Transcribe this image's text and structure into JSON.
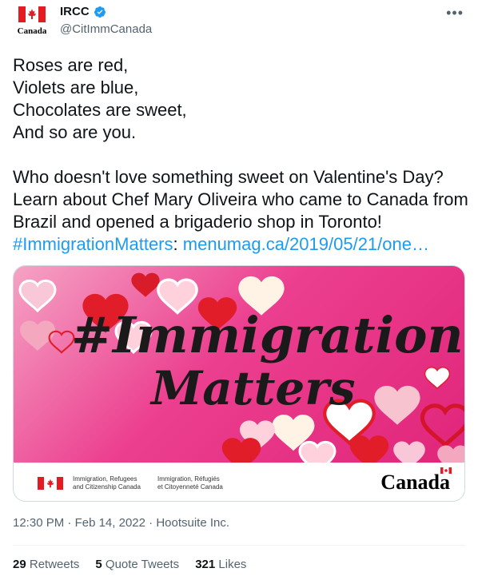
{
  "author": {
    "avatar_word": "Canada",
    "display_name": "IRCC",
    "handle": "@CitImmCanada",
    "verified": true
  },
  "tweet": {
    "text": "Roses are red,\nViolets are blue,\nChocolates are sweet,\nAnd so are you.\n\nWho doesn't love something sweet on Valentine's Day? Learn about Chef Mary Oliveira who came to Canada from Brazil and opened a brigaderio shop in Toronto!",
    "hashtag": "#ImmigrationMatters",
    "colon": ":",
    "link": "menumag.ca/2019/05/21/one…"
  },
  "media": {
    "line1": "#Immigration",
    "line2": "Matters",
    "gov_en": [
      "Immigration, Refugees",
      "and Citizenship Canada"
    ],
    "gov_fr": [
      "Immigration, Réfugiés",
      "et Citoyenneté Canada"
    ],
    "wordmark": "Canada"
  },
  "meta": {
    "time": "12:30 PM",
    "sep1": "·",
    "date": "Feb 14, 2022",
    "sep2": "·",
    "source": "Hootsuite Inc."
  },
  "stats": {
    "retweets_count": "29",
    "retweets_label": "Retweets",
    "quotes_count": "5",
    "quotes_label": "Quote Tweets",
    "likes_count": "321",
    "likes_label": "Likes"
  },
  "colors": {
    "accent": "#1d9bf0",
    "flag_red": "#e31b23",
    "pink": "#e0257a"
  },
  "icons": [
    "canada-flag-icon",
    "verified-badge-icon",
    "more-options-icon"
  ]
}
